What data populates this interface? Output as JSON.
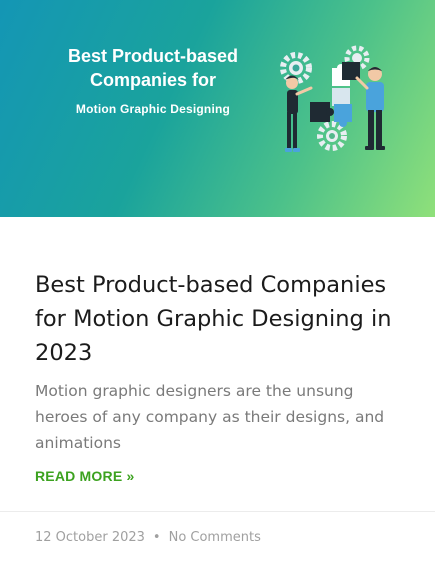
{
  "banner": {
    "title": "Best Product-based\nCompanies for",
    "subtitle": "Motion Graphic Designing",
    "illustration_icon": "team-puzzle-gears-illustration"
  },
  "post": {
    "title": "Best Product-based Companies for Motion Graphic Designing in 2023",
    "excerpt": "Motion graphic designers are the unsung heroes of any company as their designs, and animations",
    "read_more": "READ MORE »"
  },
  "meta": {
    "date": "12 October 2023",
    "separator": "•",
    "comments": "No Comments"
  },
  "colors": {
    "accent": "#3ca21f",
    "banner_start": "#1496b5",
    "banner_end": "#8fe07a"
  }
}
